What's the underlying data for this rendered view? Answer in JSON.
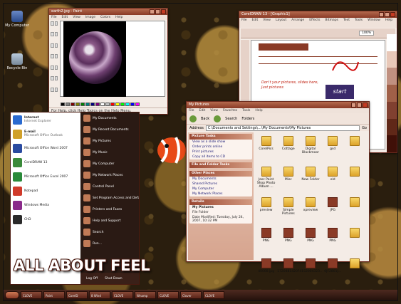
{
  "banner": "ALL ABOUT FEEL",
  "desktop": {
    "icons": [
      {
        "label": "My Computer",
        "icon": "computer-icon"
      },
      {
        "label": "Recycle Bin",
        "icon": "recycle-bin-icon"
      }
    ]
  },
  "paint": {
    "title": "earth2.jpg - Paint",
    "menu": [
      "File",
      "Edit",
      "View",
      "Image",
      "Colors",
      "Help"
    ],
    "status": "For Help, click Help Topics on the Help Menu."
  },
  "corel": {
    "title": "CorelDRAW 13 - [Graphic1]",
    "menu": [
      "File",
      "Edit",
      "View",
      "Layout",
      "Arrange",
      "Effects",
      "Bitmaps",
      "Text",
      "Tools",
      "Window",
      "Help"
    ],
    "zoom": "100%",
    "text_line": "Don't your pictures, slides here,",
    "text_line2": "Just pictures",
    "start_label": "start"
  },
  "explorer": {
    "menu": [
      "File",
      "Edit",
      "View",
      "Favorites",
      "Tools",
      "Help"
    ],
    "nav": {
      "back": "Back",
      "search": "Search",
      "folders": "Folders"
    },
    "address_label": "Address",
    "address": "C:\\Documents and Settings\\...\\My Documents\\My Pictures",
    "go": "Go",
    "picture_tasks": {
      "title": "Picture Tasks",
      "items": [
        "View as a slide show",
        "Order prints online",
        "Print pictures",
        "Copy all items to CD"
      ]
    },
    "file_tasks": {
      "title": "File and Folder Tasks"
    },
    "other_places": {
      "title": "Other Places",
      "items": [
        "My Documents",
        "Shared Pictures",
        "My Computer",
        "My Network Places"
      ]
    },
    "details": {
      "title": "Details",
      "name": "My Pictures",
      "type": "File Folder",
      "modified": "Date Modified: Tuesday, July 24, 2007, 10:32 PM"
    },
    "files": [
      {
        "name": "CorelPics",
        "kind": "folder"
      },
      {
        "name": "Cottage",
        "kind": "folder"
      },
      {
        "name": "Digital Blackmoor",
        "kind": "folder"
      },
      {
        "name": "gsd",
        "kind": "folder"
      },
      {
        "name": "",
        "kind": "folder"
      },
      {
        "name": "Jasc Paint Shop Photo Album ...",
        "kind": "folder"
      },
      {
        "name": "Misc",
        "kind": "folder"
      },
      {
        "name": "New Folder",
        "kind": "folder"
      },
      {
        "name": "old",
        "kind": "folder"
      },
      {
        "name": "",
        "kind": "folder"
      },
      {
        "name": "preview",
        "kind": "folder"
      },
      {
        "name": "Simple Pictures",
        "kind": "folder"
      },
      {
        "name": "xpreview",
        "kind": "folder"
      },
      {
        "name": "JPG",
        "kind": "img"
      },
      {
        "name": "",
        "kind": "folder"
      },
      {
        "name": "PNG",
        "kind": "img"
      },
      {
        "name": "PNG",
        "kind": "img"
      },
      {
        "name": "PNG",
        "kind": "img"
      },
      {
        "name": "PNG",
        "kind": "img"
      },
      {
        "name": "",
        "kind": "folder"
      },
      {
        "name": "40000.jpg",
        "kind": "img"
      },
      {
        "name": "1720481420P...",
        "kind": "img"
      },
      {
        "name": "4152004323...",
        "kind": "img"
      },
      {
        "name": "6JF2801J...",
        "kind": "img"
      },
      {
        "name": "",
        "kind": "folder"
      }
    ]
  },
  "start_menu": {
    "left": [
      {
        "label": "Internet",
        "sub": "Internet Explorer"
      },
      {
        "label": "E-mail",
        "sub": "Microsoft Office Outlook"
      },
      {
        "label": "Microsoft Office Word 2007"
      },
      {
        "label": "CorelDRAW 13"
      },
      {
        "label": "Microsoft Office Excel 2007"
      },
      {
        "label": "Notepad"
      },
      {
        "label": "Windows Media"
      },
      {
        "label": "ChD"
      }
    ],
    "right": [
      "My Documents",
      "My Recent Documents",
      "My Pictures",
      "My Music",
      "My Computer",
      "My Network Places",
      "Control Panel",
      "Set Program Access and Defaults",
      "Printers and Faxes",
      "Help and Support",
      "Search",
      "Run..."
    ],
    "logoff": "Log Off",
    "shutdown": "Shut Down"
  },
  "taskbar": {
    "buttons": [
      "CLOVE",
      "Paint",
      "CorelD",
      "8 Wind",
      "CLOVE",
      "Wnamp",
      "CLOVE",
      "Clover",
      "CLOVE"
    ]
  },
  "colors": {
    "accent": "#8a3a26",
    "fish": "#e84a18"
  }
}
